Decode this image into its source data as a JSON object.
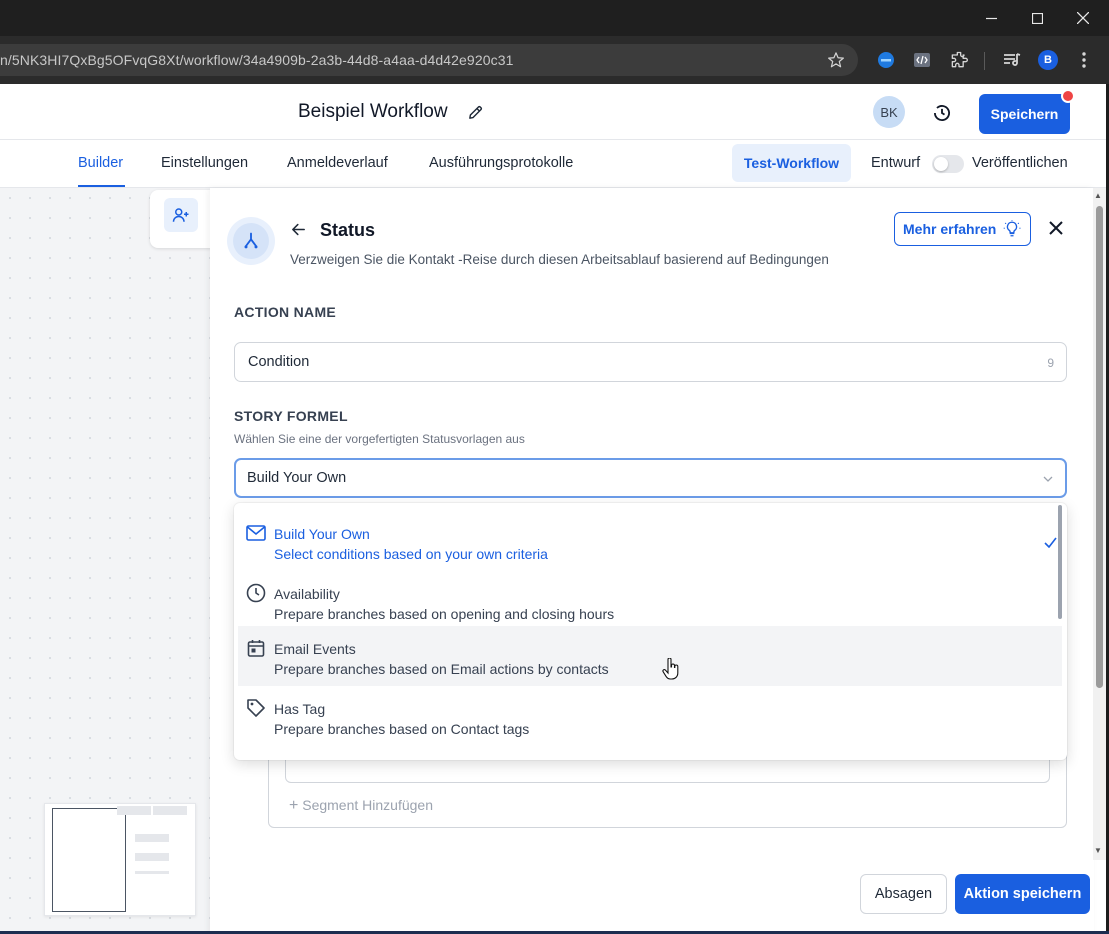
{
  "browser": {
    "url": "n/5NK3HI7QxBg5OFvqG8Xt/workflow/34a4909b-2a3b-44d8-a4aa-d4d42e920c31",
    "profile_initial": "B"
  },
  "header": {
    "title": "Beispiel Workflow",
    "avatar_initials": "BK",
    "save_label": "Speichern"
  },
  "nav": {
    "tabs": [
      {
        "label": "Builder",
        "active": true
      },
      {
        "label": "Einstellungen"
      },
      {
        "label": "Anmeldeverlauf"
      },
      {
        "label": "Ausführungsprotokolle"
      }
    ],
    "test_label": "Test-Workflow",
    "draft_label": "Entwurf",
    "publish_label": "Veröffentlichen"
  },
  "panel": {
    "title": "Status",
    "subtitle": "Verzweigen Sie die Kontakt -Reise durch diesen Arbeitsablauf basierend auf Bedingungen",
    "learn_more": "Mehr erfahren",
    "action_name_label": "ACTION NAME",
    "action_name_value": "Condition",
    "action_name_count": "9",
    "formula_label": "STORY FORMEL",
    "formula_hint": "Wählen Sie eine der vorgefertigten Statusvorlagen aus",
    "formula_value": "Build Your Own"
  },
  "dropdown": {
    "options": [
      {
        "title": "Build Your Own",
        "desc": "Select conditions based on your own criteria",
        "icon": "mail-icon",
        "selected": true
      },
      {
        "title": "Availability",
        "desc": "Prepare branches based on opening and closing hours",
        "icon": "clock-icon"
      },
      {
        "title": "Email Events",
        "desc": "Prepare branches based on Email actions by contacts",
        "icon": "calendar-icon",
        "hover": true
      },
      {
        "title": "Has Tag",
        "desc": "Prepare branches based on Contact tags",
        "icon": "tag-icon"
      }
    ]
  },
  "segment": {
    "add_label": "Segment Hinzufügen"
  },
  "footer": {
    "cancel_label": "Absagen",
    "save_label": "Aktion speichern"
  },
  "colors": {
    "primary": "#1a5fe0",
    "accent_light": "#e8f0fc",
    "notification": "#ef4444"
  }
}
